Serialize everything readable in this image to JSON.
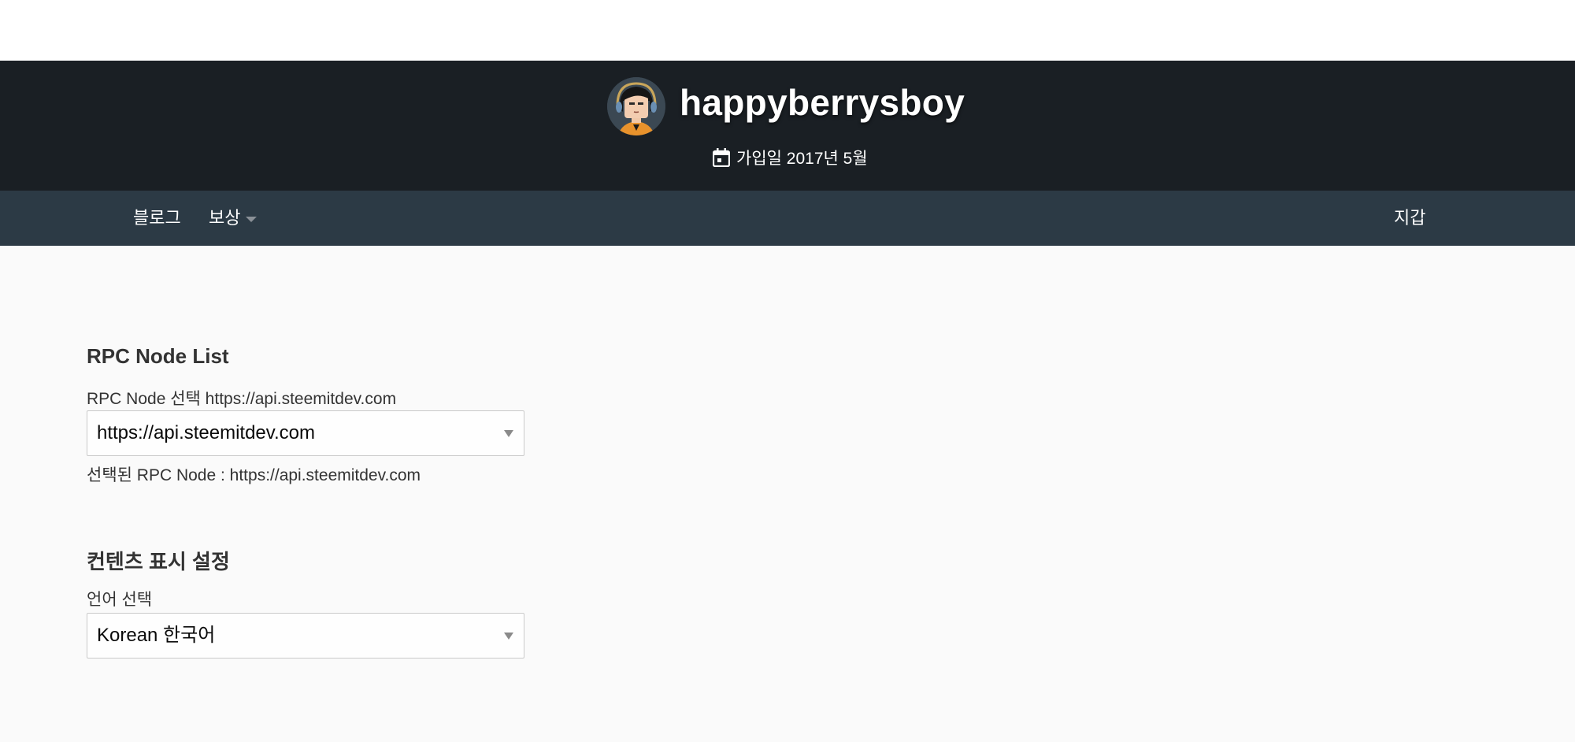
{
  "profile": {
    "username": "happyberrysboy",
    "joined": "가입일 2017년 5월"
  },
  "nav": {
    "blog": "블로그",
    "rewards": "보상",
    "wallet": "지갑"
  },
  "rpc": {
    "title": "RPC Node List",
    "select_label": "RPC Node 선택 https://api.steemitdev.com",
    "selected_value": "https://api.steemitdev.com",
    "selected_note": "선택된 RPC Node : https://api.steemitdev.com"
  },
  "content_settings": {
    "title": "컨텐츠 표시 설정",
    "language_label": "언어 선택",
    "language_value": "Korean 한국어"
  },
  "colors": {
    "header_bg": "#1a1f24",
    "nav_bg": "#2c3a45",
    "page_bg": "#fafafa"
  }
}
